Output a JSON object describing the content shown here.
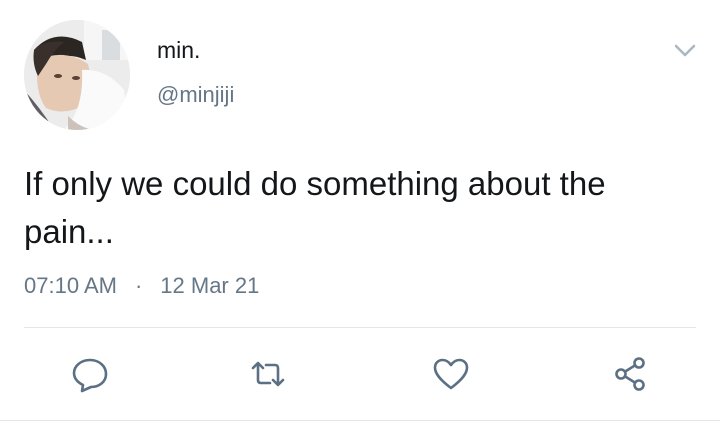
{
  "user": {
    "display_name": "min.",
    "handle": "@minjiji",
    "avatar_icon": "profile-photo"
  },
  "tweet": {
    "text": "If only we could do something about the pain...",
    "time": "07:10 AM",
    "separator": "·",
    "date": "12 Mar 21"
  },
  "actions": {
    "reply_icon": "reply-icon",
    "retweet_icon": "retweet-icon",
    "like_icon": "heart-icon",
    "share_icon": "share-icon"
  },
  "colors": {
    "text": "#14171a",
    "secondary": "#657786",
    "icon": "#5b7083",
    "divider": "#e1e8ed"
  }
}
